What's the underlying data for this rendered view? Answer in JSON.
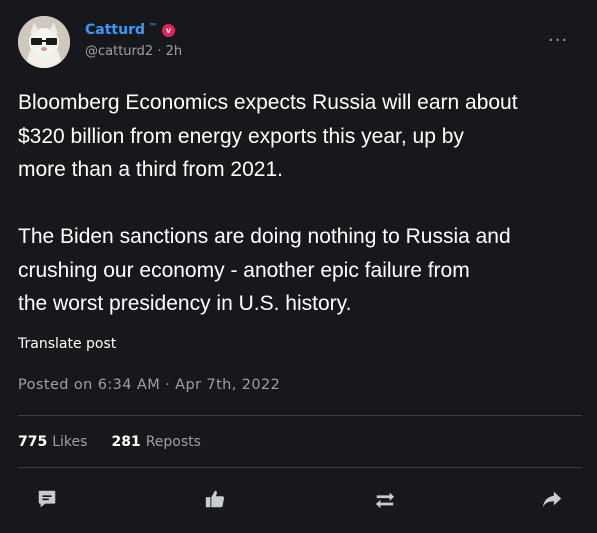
{
  "author": {
    "name": "Catturd",
    "tm": "™",
    "verified_mark": "v",
    "handle_line": "@catturd2 · 2h"
  },
  "menu": {
    "more_label": "···"
  },
  "tweet": {
    "text": "Bloomberg Economics expects Russia will earn about\n$320 billion from energy exports this year, up by\nmore than a third from 2021.\n\nThe Biden sanctions are doing nothing to Russia and\ncrushing our economy - another epic failure from\nthe worst presidency in U.S. history."
  },
  "translate_label": "Translate post",
  "posted": "Posted on 6:34 AM · Apr 7th, 2022",
  "stats": {
    "likes_count": "775",
    "likes_label": "Likes",
    "reposts_count": "281",
    "reposts_label": "Reposts"
  },
  "actions": {
    "reply_icon": "comment-icon",
    "like_icon": "thumbs-up-icon",
    "repost_icon": "repost-icon",
    "share_icon": "share-arrow-icon"
  },
  "colors": {
    "background": "#17181b",
    "name": "#3b98ff",
    "muted": "#9aa0a6",
    "badge": "#e0245e"
  }
}
